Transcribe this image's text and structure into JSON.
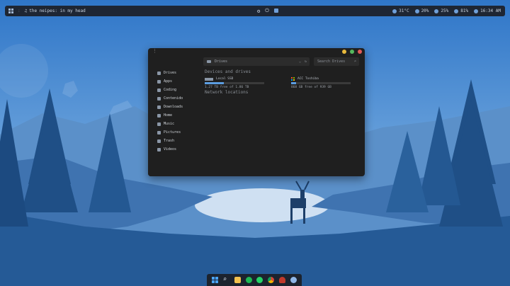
{
  "topbar": {
    "workspace_icon": "grid-icon",
    "music_icon": "music-note-icon",
    "now_playing": "the neipes: in my head",
    "center_icons": [
      "settings-icon",
      "power-icon",
      "display-icon"
    ],
    "temperature": "31°C",
    "cpu": "20%",
    "memory": "25%",
    "brightness": "81%",
    "clock": "16:34 AM"
  },
  "window": {
    "path": "Drives",
    "search_placeholder": "Search Drives",
    "sidebar": [
      {
        "label": "Drives",
        "icon": "drive-icon"
      },
      {
        "label": "Apps",
        "icon": "apps-icon"
      },
      {
        "label": "Coding",
        "icon": "code-icon"
      },
      {
        "label": "Contenido",
        "icon": "folder-icon"
      },
      {
        "label": "Downloads",
        "icon": "download-icon"
      },
      {
        "label": "Home",
        "icon": "home-icon"
      },
      {
        "label": "Music",
        "icon": "music-icon"
      },
      {
        "label": "Pictures",
        "icon": "picture-icon"
      },
      {
        "label": "Trash",
        "icon": "trash-icon"
      },
      {
        "label": "Videos",
        "icon": "video-icon"
      }
    ],
    "devices_title": "Devices and drives",
    "drives": [
      {
        "name": "Local SSD",
        "free": "1.27 TB free of 1.86 TB",
        "used_fraction": 0.32
      },
      {
        "name": "ACC Toshiba",
        "free": "868 GB free of 939 GB",
        "used_fraction": 0.08
      }
    ],
    "network_title": "Network locations"
  },
  "colors": {
    "accent": "#5c9de0",
    "close": "#e25a57",
    "minimize": "#e8b93c",
    "maximize": "#56b95e"
  },
  "taskbar": {
    "icons": [
      "windows-start-icon",
      "search-icon",
      "file-explorer-icon",
      "spotify-icon",
      "whatsapp-icon",
      "chrome-icon",
      "chess-icon",
      "network-icon"
    ]
  }
}
